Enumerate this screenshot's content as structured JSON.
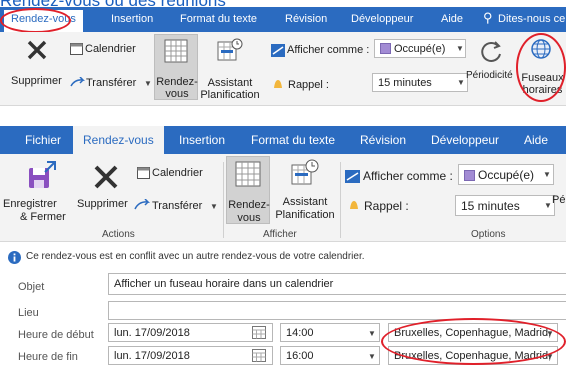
{
  "caption": "Rendez-vous ou des réunions",
  "ribbon_small": {
    "tabs": [
      "Rendez-vous",
      "Insertion",
      "Format du texte",
      "Révision",
      "Développeur",
      "Aide",
      "Dites-nous ce"
    ],
    "buttons": {
      "supprimer": "Supprimer",
      "calendrier": "Calendrier",
      "transferer": "Transférer",
      "rendez_vous": [
        "Rendez-",
        "vous"
      ],
      "assistant": [
        "Assistant",
        "Planification"
      ],
      "afficher_comme": "Afficher comme :",
      "occupe": "Occupé(e)",
      "rappel": "Rappel :",
      "minutes": "15 minutes",
      "periodicite": "Périodicité",
      "fuseaux": [
        "Fuseaux",
        "horaires"
      ]
    }
  },
  "ribbon_large": {
    "tabs": [
      "Fichier",
      "Rendez-vous",
      "Insertion",
      "Format du texte",
      "Révision",
      "Développeur",
      "Aide"
    ],
    "buttons": {
      "enregistrer": [
        "Enregistrer",
        "& Fermer"
      ],
      "supprimer": "Supprimer",
      "calendrier": "Calendrier",
      "transferer": "Transférer",
      "rendez_vous": [
        "Rendez-",
        "vous"
      ],
      "assistant": [
        "Assistant",
        "Planification"
      ],
      "afficher_comme": "Afficher comme :",
      "occupe": "Occupé(e)",
      "rappel": "Rappel :",
      "minutes": "15 minutes",
      "periodicite": "Pé"
    },
    "groups": [
      "Actions",
      "Afficher",
      "Options"
    ]
  },
  "info_message": "Ce rendez-vous est en conflit avec un autre rendez-vous de votre calendrier.",
  "form": {
    "objet_label": "Objet",
    "objet_value": "Afficher un fuseau horaire dans un calendrier",
    "lieu_label": "Lieu",
    "lieu_value": "",
    "debut_label": "Heure de début",
    "debut_date": "lun. 17/09/2018",
    "debut_time": "14:00",
    "debut_zone": "Bruxelles, Copenhague, Madrid,",
    "fin_label": "Heure de fin",
    "fin_date": "lun. 17/09/2018",
    "fin_time": "16:00",
    "fin_zone": "Bruxelles, Copenhague, Madrid,"
  },
  "colors": {
    "ribbon_blue": "#2b6bc0",
    "highlight_red": "#e0202a",
    "ribbon_bg": "#f3f3f3"
  }
}
